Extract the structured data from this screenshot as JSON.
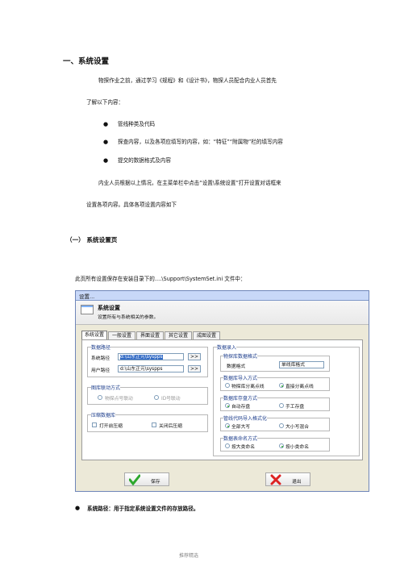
{
  "doc": {
    "h1": "一、系统设置",
    "para1": "物探作业之前，通过学习《规程》和《设计书》，物探人员配合内业人员首先",
    "para1b": "了解以下内容：",
    "bullets": [
      "管线种类及代码",
      "探查内容，以及各项应填写的内容，如：“特征”“附属物”栏的填写内容",
      "提交的数据格式及内容"
    ],
    "para2": "内业人员根据以上情况，在主菜单栏中点击“设置\\系统设置”打开设置对话框来",
    "para2b": "设置各项内容。具体各项设置内容如下",
    "h2": "（一） 系统设置页",
    "intro": "此页所有设置保存在安装目录下的....\\Support\\SystemSet.ini 文件中：",
    "after_bullet": "系统路径：用于指定系统设置文件的存放路径。",
    "footer": "推荐精选"
  },
  "dialog": {
    "title": "设置...",
    "header_title": "系统设置",
    "header_sub": "设置所有与系统相关的参数。",
    "tabs": [
      "系统设置",
      "一般设置",
      "界面设置",
      "其它设置",
      "成图设置"
    ],
    "data_path": {
      "group": "数据路径",
      "sys_label": "系统路径",
      "sys_value": "d:\\山东正元\\syspps",
      "user_label": "用户路径",
      "user_value": "d:\\山东正元\\syspps",
      "browse": ">>"
    },
    "linkage": {
      "group": "图库联动方式",
      "opt1": "物探点号联动",
      "opt2": "ID号联动"
    },
    "compress": {
      "group": "压缩数据库",
      "opt1": "打开前压缩",
      "opt2": "关闭后压缩"
    },
    "import": {
      "group": "数据录入",
      "format_group": "物探库数据格式",
      "format_label": "数据格式",
      "format_value": "单线库格式",
      "import_group": "数据库导入方式",
      "import_opt1": "物探库分离点线",
      "import_opt2": "直接分离点线",
      "save_group": "数据库存盘方式",
      "save_opt1": "自动存盘",
      "save_opt2": "手工存盘",
      "case_group": "管线代码导入格式化",
      "case_opt1": "全部大写",
      "case_opt2": "大小写混合",
      "name_group": "数据表命名方式",
      "name_opt1": "按大类命名",
      "name_opt2": "按小类命名"
    },
    "ok": "保存",
    "cancel": "退出"
  },
  "colors": {
    "accent": "#1b3c8b",
    "selection": "#316ac5"
  }
}
